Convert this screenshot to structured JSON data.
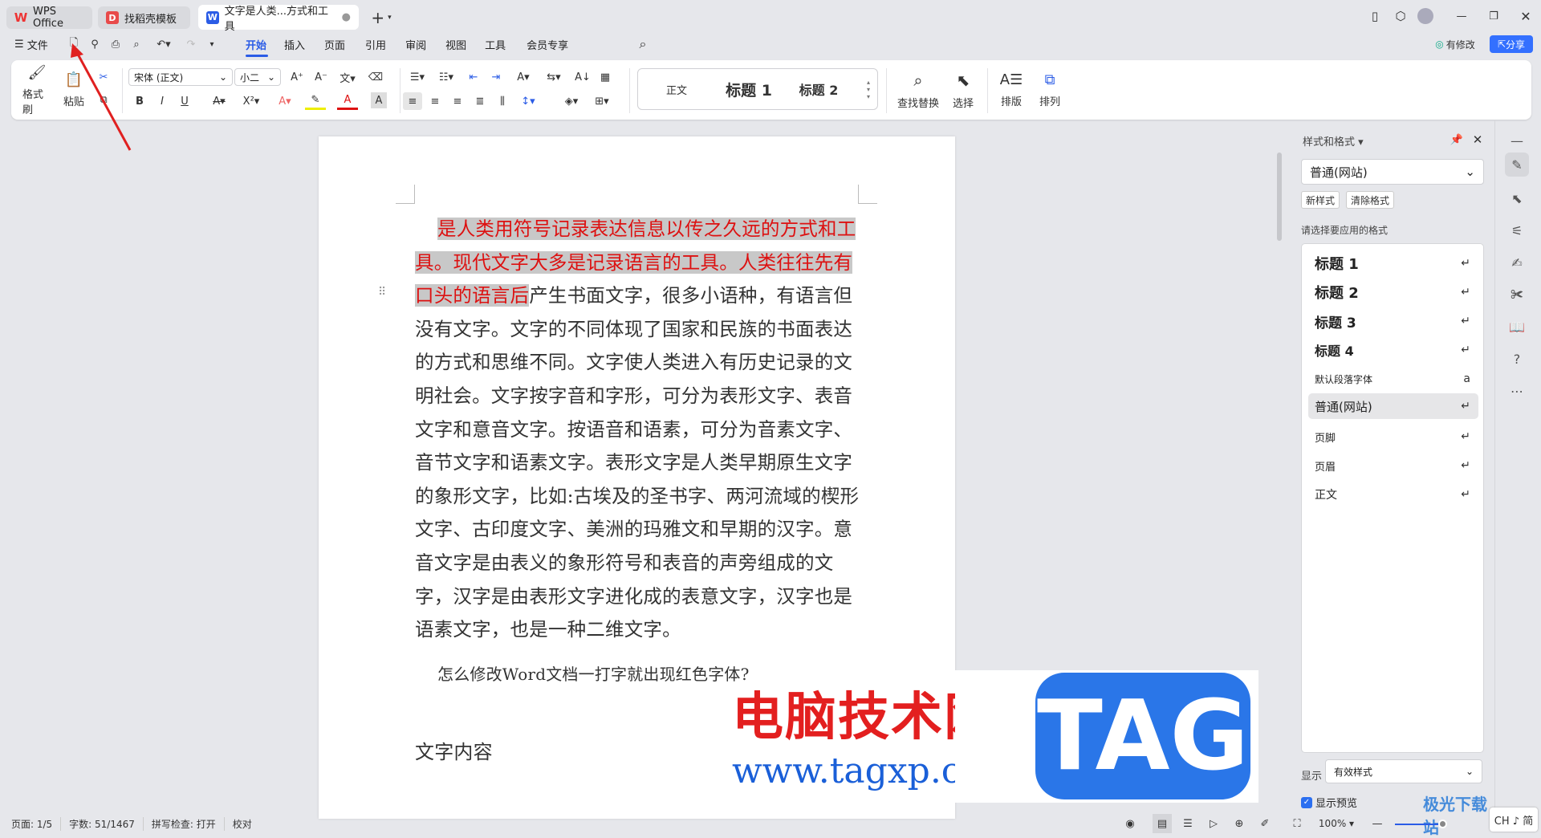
{
  "tabs": [
    {
      "label": "WPS Office",
      "icon": "wps-logo-icon"
    },
    {
      "label": "找稻壳模板",
      "icon": "docer-logo-icon"
    },
    {
      "label": "文字是人类...方式和工具",
      "icon": "writer-logo-icon",
      "active": true
    }
  ],
  "window": {
    "new_tab": "+"
  },
  "menu": {
    "file": "文件",
    "tabs": [
      "开始",
      "插入",
      "页面",
      "引用",
      "审阅",
      "视图",
      "工具",
      "会员专享"
    ],
    "active": "开始",
    "modified": "有修改",
    "share": "分享"
  },
  "ribbon": {
    "format_painter": "格式刷",
    "paste": "粘贴",
    "font": "宋体 (正文)",
    "size": "小二",
    "bold": "B",
    "italic": "I",
    "underline": "U",
    "styles": [
      "正文",
      "标题 1",
      "标题 2"
    ],
    "find_replace": "查找替换",
    "select": "选择",
    "layout": "排版",
    "arrange": "排列"
  },
  "document": {
    "highlighted": "是人类用符号记录表达信息以传之久远的方式和工具。现代文字大多是记录语言的工具。人类往往先有口头的语言后",
    "body": "产生书面文字，很多小语种，有语言但没有文字。文字的不同体现了国家和民族的书面表达的方式和思维不同。文字使人类进入有历史记录的文明社会。文字按字音和字形，可分为表形文字、表音文字和意音文字。按语音和语素，可分为音素文字、音节文字和语素文字。表形文字是人类早期原生文字的象形文字，比如:古埃及的圣书字、两河流域的楔形文字、古印度文字、美洲的玛雅文和早期的汉字。意音文字是由表义的象形符号和表音的声旁组成的文字，汉字是由表形文字进化成的表意文字，汉字也是语素文字，也是一种二维文字。",
    "question": "怎么修改Word文档一打字就出现红色字体?",
    "heading": "文字内容",
    "highlight_color": "#d11111"
  },
  "panel": {
    "title": "样式和格式",
    "current": "普通(网站)",
    "new_style": "新样式",
    "clear_format": "清除格式",
    "prompt": "请选择要应用的格式",
    "styles": [
      {
        "label": "标题 1",
        "mark": "↵"
      },
      {
        "label": "标题 2",
        "mark": "↵"
      },
      {
        "label": "标题 3",
        "mark": "↵"
      },
      {
        "label": "标题 4",
        "mark": "↵"
      },
      {
        "label": "默认段落字体",
        "mark": "a"
      },
      {
        "label": "普通(网站)",
        "mark": "↵"
      },
      {
        "label": "页脚",
        "mark": "↵"
      },
      {
        "label": "页眉",
        "mark": "↵"
      },
      {
        "label": "正文",
        "mark": "↵"
      }
    ],
    "show_label": "显示",
    "show_value": "有效样式",
    "preview_label": "显示预览",
    "preview_checked": true
  },
  "status": {
    "page": "页面: 1/5",
    "words": "字数: 51/1467",
    "spell": "拼写检查: 打开",
    "proof": "校对",
    "zoom": "100%",
    "ime": "CH ♪ 简",
    "zoom_percent": 100
  },
  "watermark": {
    "cn": "电脑技术网",
    "url": "www.tagxp.com",
    "tag": "TAG",
    "site": "极光下载站"
  },
  "colors": {
    "accent": "#2b5ce6",
    "share": "#3370ff",
    "red": "#d11111"
  }
}
